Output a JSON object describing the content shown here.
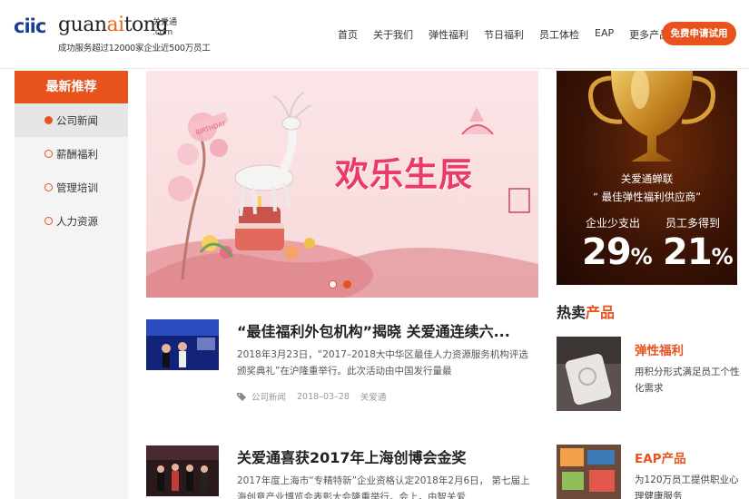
{
  "header": {
    "logo_mark": "ciic",
    "logo_word_a": "guan",
    "logo_word_ai": "ai",
    "logo_word_b": "tong",
    "logo_cn": "关爱通",
    "logo_com": ".com",
    "slogan": "成功服务超过12000家企业近500万员工",
    "nav": [
      "首页",
      "关于我们",
      "弹性福利",
      "节日福利",
      "员工体检",
      "EAP"
    ],
    "nav_more": "更多产品",
    "cta": "免费申请试用"
  },
  "sidebar": {
    "title": "最新推荐",
    "items": [
      {
        "label": "公司新闻"
      },
      {
        "label": "薪酬福利"
      },
      {
        "label": "管理培训"
      },
      {
        "label": "人力资源"
      }
    ]
  },
  "banner": {
    "title": "欢乐生辰",
    "badge": "BIRTHDAY",
    "slide_count": 2,
    "active_slide": 2
  },
  "news": [
    {
      "title": "“最佳福利外包机构”揭晓 关爱通连续六...",
      "desc": "2018年3月23日，“2017–2018大中华区最佳人力资源服务机构评选颁奖典礼”在沪隆重举行。此次活动由中国发行量最",
      "category": "公司新闻",
      "date": "2018–03–28",
      "tag": "关爱通"
    },
    {
      "title": "关爱通喜获2017年上海创博会金奖",
      "desc": "2017年度上海市“专精特新”企业资格认定2018年2月6日， 第七届上海创意产业博览会表彰大会隆重举行。会上，由智关爱"
    }
  ],
  "promo": {
    "line1": "关爱通蝉联",
    "line2": "“ 最佳弹性福利供应商”",
    "label1": "企业少支出",
    "label2": "员工多得到",
    "num1": "29",
    "num2": "21",
    "pct": "%"
  },
  "hot": {
    "title_a": "热卖",
    "title_b": "产品",
    "products": [
      {
        "name": "弹性福利",
        "desc": "用积分形式满足员工个性化需求"
      },
      {
        "name": "EAP产品",
        "desc": "为120万员工提供职业心理健康服务"
      }
    ]
  },
  "colors": {
    "accent": "#e8521c",
    "brand_blue": "#1b3f8f"
  }
}
